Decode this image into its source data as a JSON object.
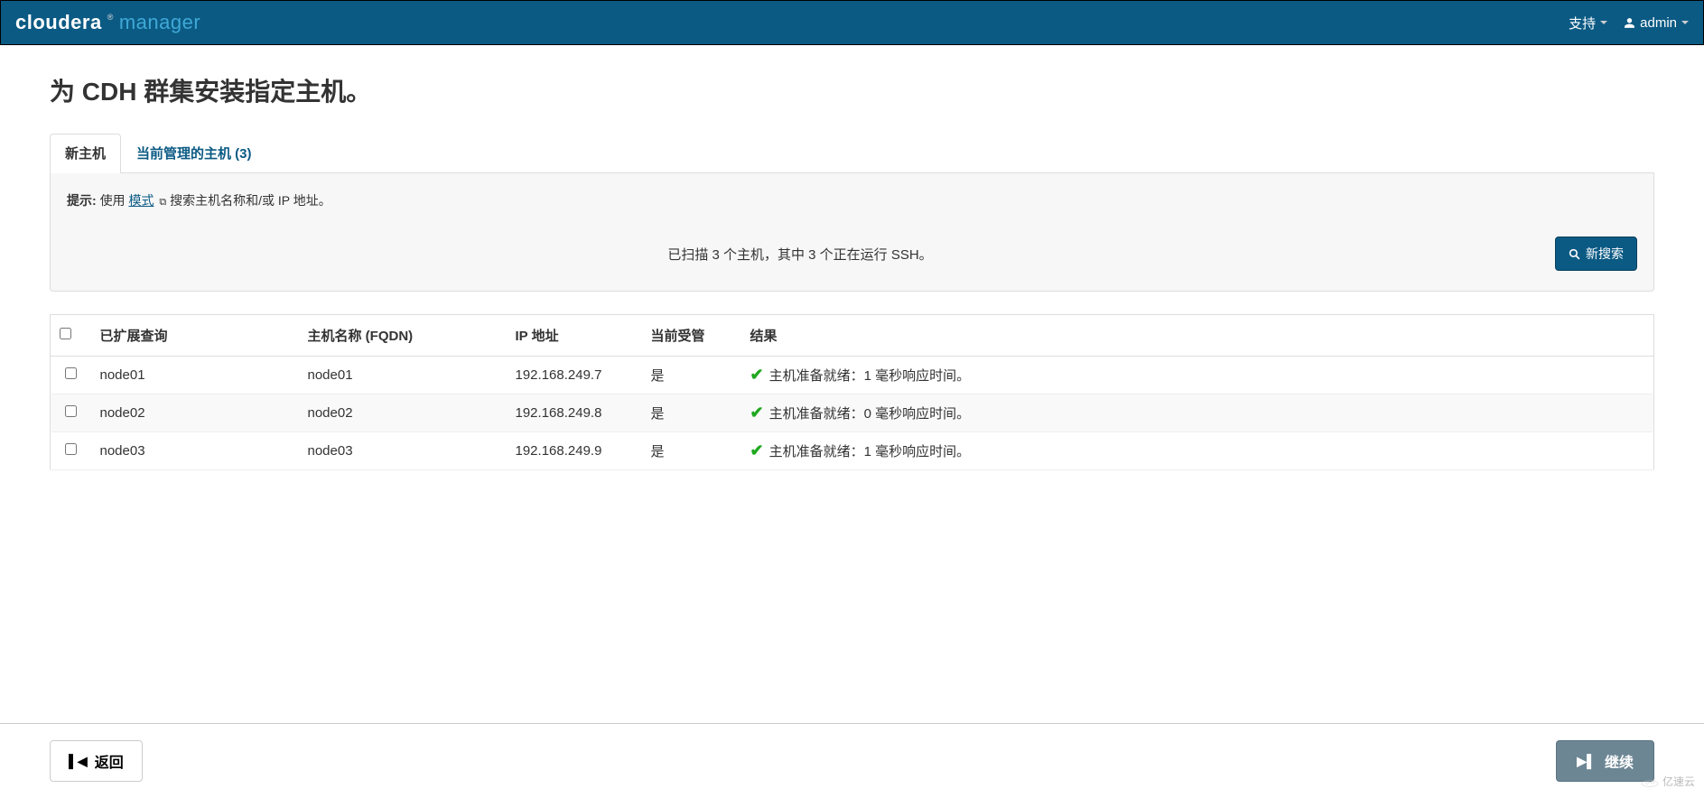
{
  "navbar": {
    "brand_cloudera": "cloudera",
    "brand_manager": "manager",
    "support_label": "支持",
    "user_label": "admin"
  },
  "page": {
    "title": "为 CDH 群集安装指定主机。"
  },
  "tabs": {
    "new_hosts": "新主机",
    "managed_hosts": "当前管理的主机 (3)"
  },
  "tip": {
    "label": "提示:",
    "prefix": " 使用",
    "link": "模式",
    "suffix": "搜索主机名称和/或 IP 地址。"
  },
  "scan": {
    "status": "已扫描 3 个主机，其中 3 个正在运行 SSH。",
    "new_search": "新搜索"
  },
  "table": {
    "headers": {
      "expanded": "已扩展查询",
      "fqdn": "主机名称 (FQDN)",
      "ip": "IP 地址",
      "managed": "当前受管",
      "result": "结果"
    },
    "rows": [
      {
        "expanded": "node01",
        "fqdn": "node01",
        "ip": "192.168.249.7",
        "managed": "是",
        "result": "主机准备就绪：1 毫秒响应时间。"
      },
      {
        "expanded": "node02",
        "fqdn": "node02",
        "ip": "192.168.249.8",
        "managed": "是",
        "result": "主机准备就绪：0 毫秒响应时间。"
      },
      {
        "expanded": "node03",
        "fqdn": "node03",
        "ip": "192.168.249.9",
        "managed": "是",
        "result": "主机准备就绪：1 毫秒响应时间。"
      }
    ]
  },
  "footer": {
    "back": "返回",
    "continue": "继续"
  },
  "watermark": "亿速云"
}
